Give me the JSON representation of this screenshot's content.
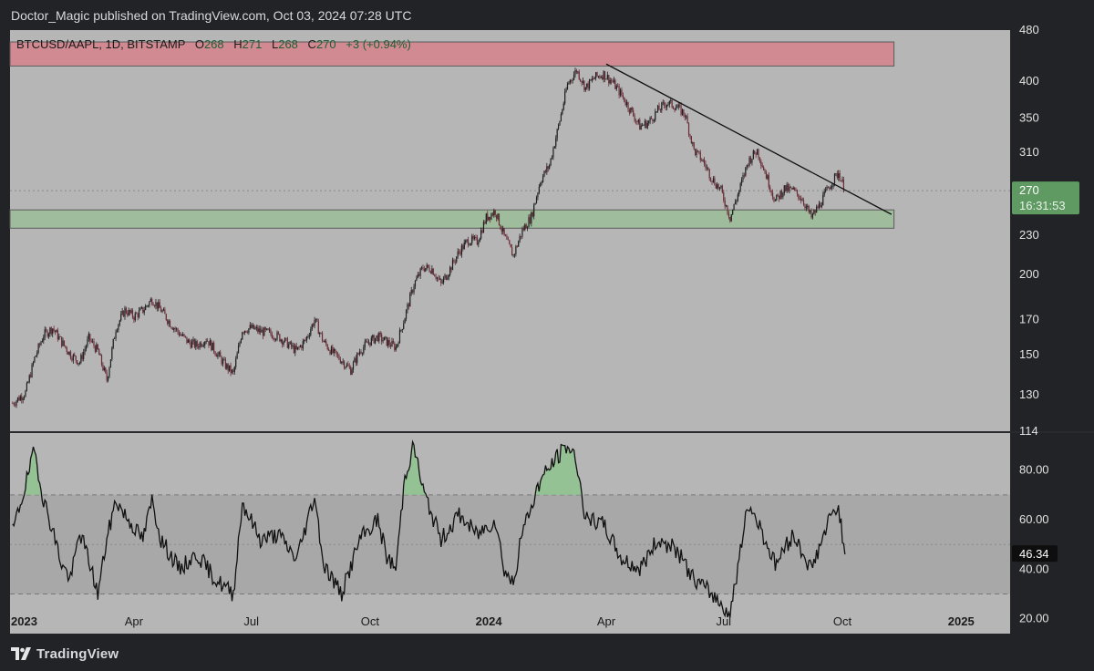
{
  "header": {
    "publisher_line": "Doctor_Magic published on TradingView.com, Oct 03, 2024 07:28 UTC"
  },
  "footer": {
    "brand": "TradingView",
    "logo_icon": "tradingview-logo-icon"
  },
  "legend": {
    "symbol": "BTCUSD/AAPL, 1D, BITSTAMP",
    "o_label": "O",
    "o_value": "268",
    "h_label": "H",
    "h_value": "271",
    "l_label": "L",
    "l_value": "268",
    "c_label": "C",
    "c_value": "270",
    "change": "+3 (+0.94%)"
  },
  "price_badge": {
    "price": "270",
    "countdown": "16:31:53"
  },
  "rsi_badge": {
    "value": "46.34"
  },
  "colors": {
    "background": "#222326",
    "pane": "#b6b6b6",
    "candle_up": "#1e1f20",
    "candle_down": "#6a2b36",
    "resistance_zone": "#d28a92",
    "support_zone": "#9fbc9c",
    "badge_green": "#5f9a63",
    "legend_value": "#1f5e34"
  },
  "chart_data": [
    {
      "type": "candlestick",
      "series_name": "BTCUSD/AAPL",
      "scale": "log",
      "ylim": [
        114,
        480
      ],
      "y_ticks": [
        "480",
        "400",
        "350",
        "310",
        "230",
        "200",
        "170",
        "150",
        "130",
        "114"
      ],
      "x_ticks": [
        {
          "label": "2023",
          "date": "2023-01-01"
        },
        {
          "label": "Apr",
          "date": "2023-04-01"
        },
        {
          "label": "Jul",
          "date": "2023-07-01"
        },
        {
          "label": "Oct",
          "date": "2023-10-01"
        },
        {
          "label": "2024",
          "date": "2024-01-01"
        },
        {
          "label": "Apr",
          "date": "2024-04-01"
        },
        {
          "label": "Jul",
          "date": "2024-07-01"
        },
        {
          "label": "Oct",
          "date": "2024-10-01"
        },
        {
          "label": "2025",
          "date": "2025-01-01"
        }
      ],
      "last_price": 270,
      "resistance_zone": {
        "low": 422,
        "high": 460,
        "end_date": "2024-11-10"
      },
      "support_zone": {
        "low": 236,
        "high": 252,
        "end_date": "2024-11-10"
      },
      "trendline": {
        "start": {
          "date": "2024-04-01",
          "value": 425
        },
        "end": {
          "date": "2024-11-08",
          "value": 248
        }
      },
      "series": [
        {
          "date": "2022-12-28",
          "close": 126
        },
        {
          "date": "2023-01-07",
          "close": 131
        },
        {
          "date": "2023-01-14",
          "close": 148
        },
        {
          "date": "2023-01-21",
          "close": 161
        },
        {
          "date": "2023-01-28",
          "close": 165
        },
        {
          "date": "2023-02-04",
          "close": 157
        },
        {
          "date": "2023-02-11",
          "close": 150
        },
        {
          "date": "2023-02-18",
          "close": 146
        },
        {
          "date": "2023-02-25",
          "close": 159
        },
        {
          "date": "2023-03-04",
          "close": 152
        },
        {
          "date": "2023-03-11",
          "close": 137
        },
        {
          "date": "2023-03-18",
          "close": 165
        },
        {
          "date": "2023-03-25",
          "close": 176
        },
        {
          "date": "2023-04-01",
          "close": 172
        },
        {
          "date": "2023-04-08",
          "close": 176
        },
        {
          "date": "2023-04-15",
          "close": 183
        },
        {
          "date": "2023-04-22",
          "close": 176
        },
        {
          "date": "2023-04-29",
          "close": 168
        },
        {
          "date": "2023-05-06",
          "close": 162
        },
        {
          "date": "2023-05-13",
          "close": 157
        },
        {
          "date": "2023-05-20",
          "close": 155
        },
        {
          "date": "2023-05-27",
          "close": 159
        },
        {
          "date": "2023-06-03",
          "close": 152
        },
        {
          "date": "2023-06-10",
          "close": 145
        },
        {
          "date": "2023-06-17",
          "close": 140
        },
        {
          "date": "2023-06-24",
          "close": 164
        },
        {
          "date": "2023-07-01",
          "close": 165
        },
        {
          "date": "2023-07-08",
          "close": 163
        },
        {
          "date": "2023-07-15",
          "close": 162
        },
        {
          "date": "2023-07-22",
          "close": 160
        },
        {
          "date": "2023-07-29",
          "close": 156
        },
        {
          "date": "2023-08-05",
          "close": 152
        },
        {
          "date": "2023-08-12",
          "close": 158
        },
        {
          "date": "2023-08-19",
          "close": 170
        },
        {
          "date": "2023-08-26",
          "close": 157
        },
        {
          "date": "2023-09-02",
          "close": 151
        },
        {
          "date": "2023-09-09",
          "close": 147
        },
        {
          "date": "2023-09-16",
          "close": 142
        },
        {
          "date": "2023-09-23",
          "close": 152
        },
        {
          "date": "2023-09-30",
          "close": 157
        },
        {
          "date": "2023-10-07",
          "close": 160
        },
        {
          "date": "2023-10-14",
          "close": 157
        },
        {
          "date": "2023-10-21",
          "close": 154
        },
        {
          "date": "2023-10-28",
          "close": 172
        },
        {
          "date": "2023-11-04",
          "close": 193
        },
        {
          "date": "2023-11-11",
          "close": 205
        },
        {
          "date": "2023-11-18",
          "close": 204
        },
        {
          "date": "2023-11-25",
          "close": 193
        },
        {
          "date": "2023-12-02",
          "close": 204
        },
        {
          "date": "2023-12-09",
          "close": 217
        },
        {
          "date": "2023-12-16",
          "close": 226
        },
        {
          "date": "2023-12-23",
          "close": 225
        },
        {
          "date": "2023-12-30",
          "close": 245
        },
        {
          "date": "2024-01-06",
          "close": 251
        },
        {
          "date": "2024-01-13",
          "close": 229
        },
        {
          "date": "2024-01-20",
          "close": 214
        },
        {
          "date": "2024-01-27",
          "close": 234
        },
        {
          "date": "2024-02-03",
          "close": 246
        },
        {
          "date": "2024-02-10",
          "close": 280
        },
        {
          "date": "2024-02-17",
          "close": 296
        },
        {
          "date": "2024-02-24",
          "close": 340
        },
        {
          "date": "2024-03-02",
          "close": 395
        },
        {
          "date": "2024-03-09",
          "close": 416
        },
        {
          "date": "2024-03-16",
          "close": 390
        },
        {
          "date": "2024-03-23",
          "close": 405
        },
        {
          "date": "2024-03-30",
          "close": 410
        },
        {
          "date": "2024-04-06",
          "close": 398
        },
        {
          "date": "2024-04-13",
          "close": 380
        },
        {
          "date": "2024-04-20",
          "close": 360
        },
        {
          "date": "2024-04-27",
          "close": 340
        },
        {
          "date": "2024-05-04",
          "close": 345
        },
        {
          "date": "2024-05-11",
          "close": 360
        },
        {
          "date": "2024-05-18",
          "close": 370
        },
        {
          "date": "2024-05-25",
          "close": 365
        },
        {
          "date": "2024-06-01",
          "close": 355
        },
        {
          "date": "2024-06-08",
          "close": 312
        },
        {
          "date": "2024-06-15",
          "close": 300
        },
        {
          "date": "2024-06-22",
          "close": 282
        },
        {
          "date": "2024-06-29",
          "close": 270
        },
        {
          "date": "2024-07-06",
          "close": 245
        },
        {
          "date": "2024-07-13",
          "close": 270
        },
        {
          "date": "2024-07-20",
          "close": 300
        },
        {
          "date": "2024-07-27",
          "close": 312
        },
        {
          "date": "2024-08-03",
          "close": 285
        },
        {
          "date": "2024-08-10",
          "close": 260
        },
        {
          "date": "2024-08-17",
          "close": 272
        },
        {
          "date": "2024-08-24",
          "close": 270
        },
        {
          "date": "2024-08-31",
          "close": 262
        },
        {
          "date": "2024-09-07",
          "close": 245
        },
        {
          "date": "2024-09-14",
          "close": 258
        },
        {
          "date": "2024-09-21",
          "close": 275
        },
        {
          "date": "2024-09-28",
          "close": 288
        },
        {
          "date": "2024-10-03",
          "close": 270
        }
      ]
    },
    {
      "type": "line",
      "series_name": "RSI",
      "ylim": [
        14,
        95
      ],
      "y_ticks": [
        "80.00",
        "60.00",
        "40.00",
        "20.00"
      ],
      "overbought": 70,
      "middle": 50,
      "oversold": 30,
      "last_value": 46.34,
      "series": [
        {
          "date": "2022-12-28",
          "value": 55
        },
        {
          "date": "2023-01-07",
          "value": 74
        },
        {
          "date": "2023-01-14",
          "value": 88
        },
        {
          "date": "2023-01-21",
          "value": 68
        },
        {
          "date": "2023-01-28",
          "value": 56
        },
        {
          "date": "2023-02-04",
          "value": 42
        },
        {
          "date": "2023-02-11",
          "value": 36
        },
        {
          "date": "2023-02-18",
          "value": 55
        },
        {
          "date": "2023-02-25",
          "value": 44
        },
        {
          "date": "2023-03-04",
          "value": 30
        },
        {
          "date": "2023-03-11",
          "value": 52
        },
        {
          "date": "2023-03-18",
          "value": 68
        },
        {
          "date": "2023-03-25",
          "value": 62
        },
        {
          "date": "2023-04-08",
          "value": 52
        },
        {
          "date": "2023-04-15",
          "value": 68
        },
        {
          "date": "2023-04-22",
          "value": 52
        },
        {
          "date": "2023-05-06",
          "value": 40
        },
        {
          "date": "2023-05-20",
          "value": 46
        },
        {
          "date": "2023-06-03",
          "value": 36
        },
        {
          "date": "2023-06-17",
          "value": 30
        },
        {
          "date": "2023-06-24",
          "value": 67
        },
        {
          "date": "2023-07-08",
          "value": 52
        },
        {
          "date": "2023-07-22",
          "value": 54
        },
        {
          "date": "2023-08-05",
          "value": 44
        },
        {
          "date": "2023-08-19",
          "value": 70
        },
        {
          "date": "2023-08-26",
          "value": 42
        },
        {
          "date": "2023-09-09",
          "value": 30
        },
        {
          "date": "2023-09-23",
          "value": 52
        },
        {
          "date": "2023-10-07",
          "value": 60
        },
        {
          "date": "2023-10-14",
          "value": 45
        },
        {
          "date": "2023-10-21",
          "value": 40
        },
        {
          "date": "2023-10-28",
          "value": 78
        },
        {
          "date": "2023-11-04",
          "value": 90
        },
        {
          "date": "2023-11-11",
          "value": 72
        },
        {
          "date": "2023-11-25",
          "value": 52
        },
        {
          "date": "2023-12-09",
          "value": 62
        },
        {
          "date": "2023-12-23",
          "value": 54
        },
        {
          "date": "2024-01-06",
          "value": 60
        },
        {
          "date": "2024-01-13",
          "value": 40
        },
        {
          "date": "2024-01-20",
          "value": 34
        },
        {
          "date": "2024-01-27",
          "value": 55
        },
        {
          "date": "2024-02-10",
          "value": 76
        },
        {
          "date": "2024-02-24",
          "value": 86
        },
        {
          "date": "2024-03-02",
          "value": 90
        },
        {
          "date": "2024-03-09",
          "value": 84
        },
        {
          "date": "2024-03-16",
          "value": 60
        },
        {
          "date": "2024-03-30",
          "value": 58
        },
        {
          "date": "2024-04-13",
          "value": 44
        },
        {
          "date": "2024-04-27",
          "value": 40
        },
        {
          "date": "2024-05-11",
          "value": 52
        },
        {
          "date": "2024-05-25",
          "value": 48
        },
        {
          "date": "2024-06-08",
          "value": 36
        },
        {
          "date": "2024-06-22",
          "value": 30
        },
        {
          "date": "2024-07-06",
          "value": 22
        },
        {
          "date": "2024-07-20",
          "value": 66
        },
        {
          "date": "2024-07-27",
          "value": 60
        },
        {
          "date": "2024-08-10",
          "value": 42
        },
        {
          "date": "2024-08-24",
          "value": 54
        },
        {
          "date": "2024-09-07",
          "value": 40
        },
        {
          "date": "2024-09-21",
          "value": 60
        },
        {
          "date": "2024-09-28",
          "value": 66
        },
        {
          "date": "2024-10-03",
          "value": 46
        }
      ]
    }
  ]
}
